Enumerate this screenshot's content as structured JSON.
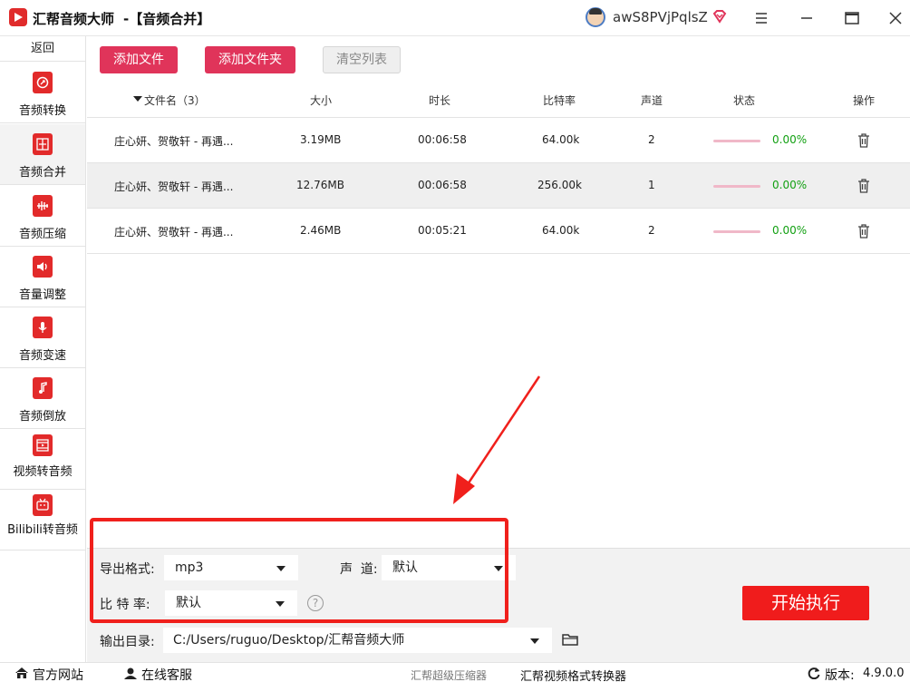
{
  "titlebar": {
    "app_name": "汇帮音频大师",
    "subtitle": "-【音频合并】",
    "username": "awS8PVjPqlsZ"
  },
  "sidebar": {
    "back_label": "返回",
    "items": [
      {
        "label": "音频转换",
        "icon": "audio-convert-icon",
        "active": false
      },
      {
        "label": "音频合并",
        "icon": "audio-merge-icon",
        "active": true
      },
      {
        "label": "音频压缩",
        "icon": "audio-compress-icon",
        "active": false
      },
      {
        "label": "音量调整",
        "icon": "volume-icon",
        "active": false
      },
      {
        "label": "音频变速",
        "icon": "microphone-icon",
        "active": false
      },
      {
        "label": "音频倒放",
        "icon": "music-note-icon",
        "active": false
      },
      {
        "label": "视频转音频",
        "icon": "film-icon",
        "active": false
      },
      {
        "label": "Bilibili转音频",
        "icon": "tv-icon",
        "active": false
      }
    ]
  },
  "toolbar": {
    "add_file": "添加文件",
    "add_folder": "添加文件夹",
    "clear_list": "清空列表"
  },
  "table": {
    "headers": {
      "filename": "文件名（3）",
      "size": "大小",
      "duration": "时长",
      "bitrate": "比特率",
      "channels": "声道",
      "status": "状态",
      "action": "操作"
    },
    "rows": [
      {
        "name": "庄心妍、贺敬轩 - 再遇...",
        "size": "3.19MB",
        "duration": "00:06:58",
        "bitrate": "64.00k",
        "channels": "2",
        "progress": 0,
        "status": "0.00%"
      },
      {
        "name": "庄心妍、贺敬轩 - 再遇...",
        "size": "12.76MB",
        "duration": "00:06:58",
        "bitrate": "256.00k",
        "channels": "1",
        "progress": 0,
        "status": "0.00%"
      },
      {
        "name": "庄心妍、贺敬轩 - 再遇...",
        "size": "2.46MB",
        "duration": "00:05:21",
        "bitrate": "64.00k",
        "channels": "2",
        "progress": 0,
        "status": "0.00%"
      }
    ]
  },
  "settings": {
    "format_label": "导出格式:",
    "format_value": "mp3",
    "channel_label": "声  道:",
    "channel_value": "默认",
    "bitrate_label": "比 特 率:",
    "bitrate_value": "默认",
    "help": "?",
    "output_label": "输出目录:",
    "output_value": "C:/Users/ruguo/Desktop/汇帮音频大师",
    "start_button": "开始执行"
  },
  "statusbar": {
    "website": "官方网站",
    "support": "在线客服",
    "link1": "汇帮超级压缩器",
    "link2": "汇帮视频格式转换器",
    "version_label": "版本:",
    "version": "4.9.0.0"
  },
  "colors": {
    "accent": "#e0345a",
    "start": "#f01c1c",
    "status_green": "#12a012",
    "annotation": "#f0201c"
  }
}
